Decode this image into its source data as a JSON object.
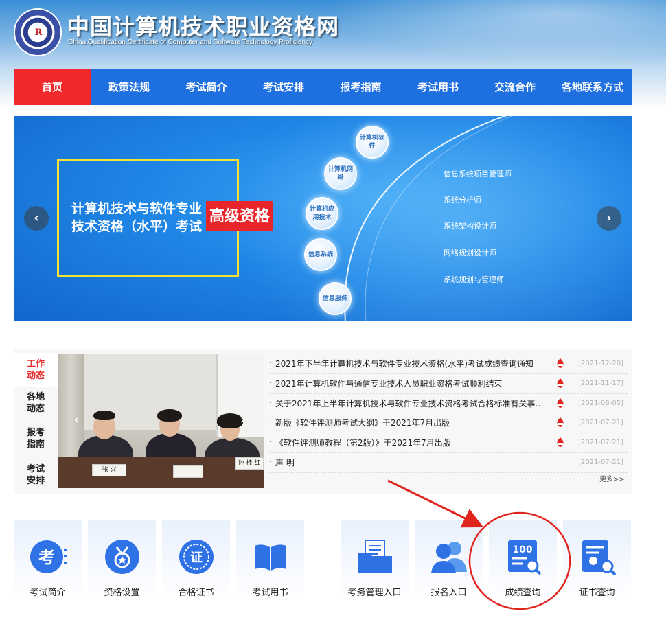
{
  "header": {
    "title": "中国计算机技术职业资格网",
    "subtitle": "China Qualification Certificate of Computer and Software Technology Proficiency",
    "logo_mark": "R"
  },
  "nav": {
    "items": [
      {
        "label": "首页",
        "active": true
      },
      {
        "label": "政策法规"
      },
      {
        "label": "考试简介"
      },
      {
        "label": "考试安排"
      },
      {
        "label": "报考指南"
      },
      {
        "label": "考试用书"
      },
      {
        "label": "交流合作"
      },
      {
        "label": "各地联系方式"
      }
    ]
  },
  "banner": {
    "line1": "计算机技术与软件专业",
    "line2": "技术资格（水平）考试",
    "tag": "高级资格",
    "nodes": [
      "计算机软件",
      "计算机网络",
      "计算机应用技术",
      "信息系统",
      "信息服务"
    ],
    "roles": [
      "信息系统项目管理师",
      "系统分析师",
      "系统架构设计师",
      "网络规划设计师",
      "系统规划与管理师"
    ],
    "prev_arrow": "‹",
    "next_arrow": "›"
  },
  "news": {
    "tabs": [
      {
        "label": "工作动态",
        "active": true
      },
      {
        "label": "各地动态"
      },
      {
        "label": "报考指南"
      },
      {
        "label": "考试安排"
      }
    ],
    "photo": {
      "prev": "‹",
      "next": "›",
      "nameplates": [
        "张 兴",
        "",
        "孙 桂 红"
      ]
    },
    "items": [
      {
        "title": "2021年下半年计算机技术与软件专业技术资格(水平)考试成绩查询通知",
        "date": "[2021-12-20]",
        "hot": true
      },
      {
        "title": "2021年计算机软件与通信专业技术人员职业资格考试顺利结束",
        "date": "[2021-11-17]",
        "hot": true
      },
      {
        "title": "关于2021年上半年计算机技术与软件专业技术资格考试合格标准有关事项...",
        "date": "[2021-08-05]",
        "hot": true
      },
      {
        "title": "新版《软件评测师考试大纲》于2021年7月出版",
        "date": "[2021-07-21]",
        "hot": true
      },
      {
        "title": "《软件评测师教程（第2版）》于2021年7月出版",
        "date": "[2021-07-21]",
        "hot": true
      },
      {
        "title": "声 明",
        "date": "[2021-07-21]",
        "hot": false
      }
    ],
    "bullet": "·",
    "more": "更多>>"
  },
  "tiles": [
    {
      "label": "考试简介",
      "icon": "exam-intro-icon",
      "glyph": "考"
    },
    {
      "label": "资格设置",
      "icon": "medal-icon"
    },
    {
      "label": "合格证书",
      "icon": "certificate-seal-icon",
      "glyph": "证"
    },
    {
      "label": "考试用书",
      "icon": "book-icon"
    },
    {
      "label": "考务管理入口",
      "icon": "folder-document-icon"
    },
    {
      "label": "报名入口",
      "icon": "users-icon"
    },
    {
      "label": "成绩查询",
      "icon": "score-search-icon",
      "glyph": "100"
    },
    {
      "label": "证书查询",
      "icon": "certificate-search-icon"
    }
  ],
  "colors": {
    "nav_blue": "#1e6fe0",
    "nav_active": "#f0292c",
    "icon_blue": "#2e72e6",
    "annotation_red": "#e0251f"
  }
}
